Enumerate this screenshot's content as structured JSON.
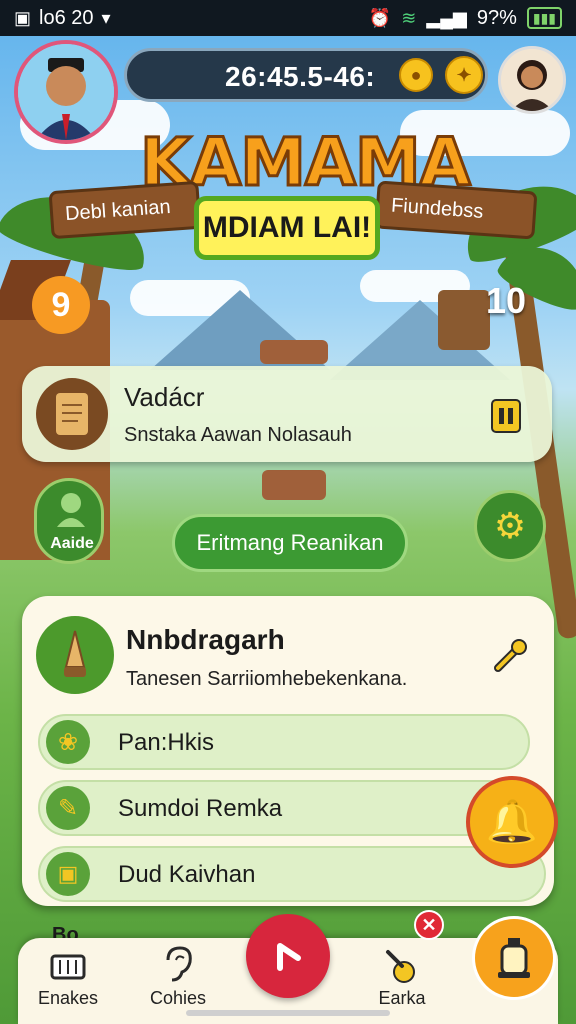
{
  "status_bar": {
    "left_text": "lo6 20",
    "percent": "9?%"
  },
  "header": {
    "score": "26:45.5-46:",
    "logo_title": "KAMAMA",
    "banner_left": "Debl kanian",
    "banner_center": "MDIAM LAI!",
    "banner_right": "Fiundebss",
    "counter_left": "9",
    "counter_right": "10"
  },
  "quest_card": {
    "title": "Vadácr",
    "subtitle": "Snstaka Aawan Nolasauh"
  },
  "side_button_left_label": "Aaide",
  "explore_button_label": "Eritmang Reanikan",
  "panel": {
    "title": "Nnbdragarh",
    "subtitle": "Tanesen Sarriiomhebekenkana.",
    "items": [
      {
        "label": "Pan:Hkis"
      },
      {
        "label": "Sumdoi Remka"
      },
      {
        "label": "Dud Kaivhan"
      }
    ],
    "peek_text": "Bo"
  },
  "bottom_nav": {
    "items": [
      {
        "label": "Enakes"
      },
      {
        "label": "Cohies"
      },
      {
        "label": "Earka"
      }
    ]
  },
  "colors": {
    "accent_red": "#d7263d",
    "accent_orange": "#f7a21c",
    "accent_green": "#3c9a33"
  }
}
